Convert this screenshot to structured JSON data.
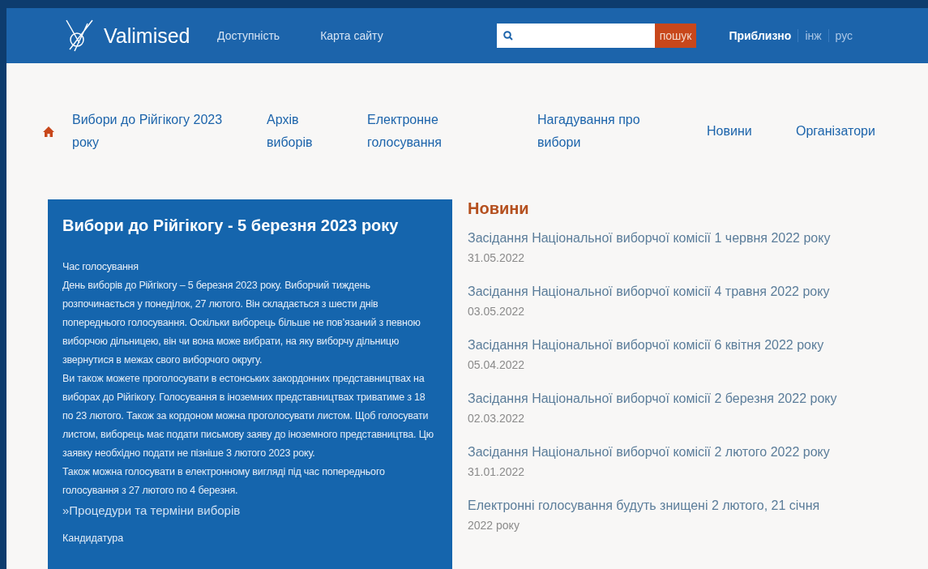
{
  "header": {
    "logo": "Valimised",
    "links": [
      "Доступність",
      "Карта сайту"
    ],
    "search": {
      "button": "пошук"
    },
    "languages": [
      {
        "label": "Приблизно",
        "selected": true
      },
      {
        "label": "інж",
        "selected": false
      },
      {
        "label": "рус",
        "selected": false
      }
    ]
  },
  "menu": [
    "Вибори до Рійгікогу 2023 року",
    "Архів виборів",
    "Електронне голосування",
    "Нагадування про вибори",
    "Новини",
    "Організатори"
  ],
  "card": {
    "title": "Вибори до Рійгікогу - 5 березня 2023 року",
    "section": "Час голосування",
    "paragraphs": [
      "День виборів до Рійгікогу – 5 березня 2023 року. Виборчий тиждень розпочинається у понеділок, 27 лютого. Він складається з шести днів попереднього голосування. Оскільки виборець більше не пов’язаний з певною виборчою дільницею, він чи вона може вибрати, на яку виборчу дільницю звернутися в межах свого виборчого округу.",
      "Ви також можете проголосувати в естонських закордонних представництвах на виборах до Рійгікогу. Голосування в іноземних представництвах триватиме з 18 по 23 лютого. Також за кордоном можна проголосувати листом. Щоб голосувати листом, виборець має подати письмову заяву до іноземного представництва. Цю заявку необхідно подати не пізніше 3 лютого 2023 року.",
      "Також можна голосувати в електронному вигляді під час попереднього голосування з 27 лютого по 4 березня."
    ],
    "link": "»Процедури та терміни виборів",
    "next_section": "Кандидатура"
  },
  "news": {
    "title": "Новини",
    "items": [
      {
        "title": "Засідання Національної виборчої комісії 1 червня 2022 року",
        "date": "31.05.2022"
      },
      {
        "title": "Засідання Національної виборчої комісії 4 травня 2022 року",
        "date": "03.05.2022"
      },
      {
        "title": "Засідання Національної виборчої комісії 6 квітня 2022 року",
        "date": "05.04.2022"
      },
      {
        "title": "Засідання Національної виборчої комісії 2 березня 2022 року",
        "date": "02.03.2022"
      },
      {
        "title": "Засідання Національної виборчої комісії 2 лютого 2022 року",
        "date": "31.01.2022"
      },
      {
        "title": "Електронні голосування будуть знищені 2 лютого, 21 січня",
        "date": "2022 року"
      }
    ]
  }
}
